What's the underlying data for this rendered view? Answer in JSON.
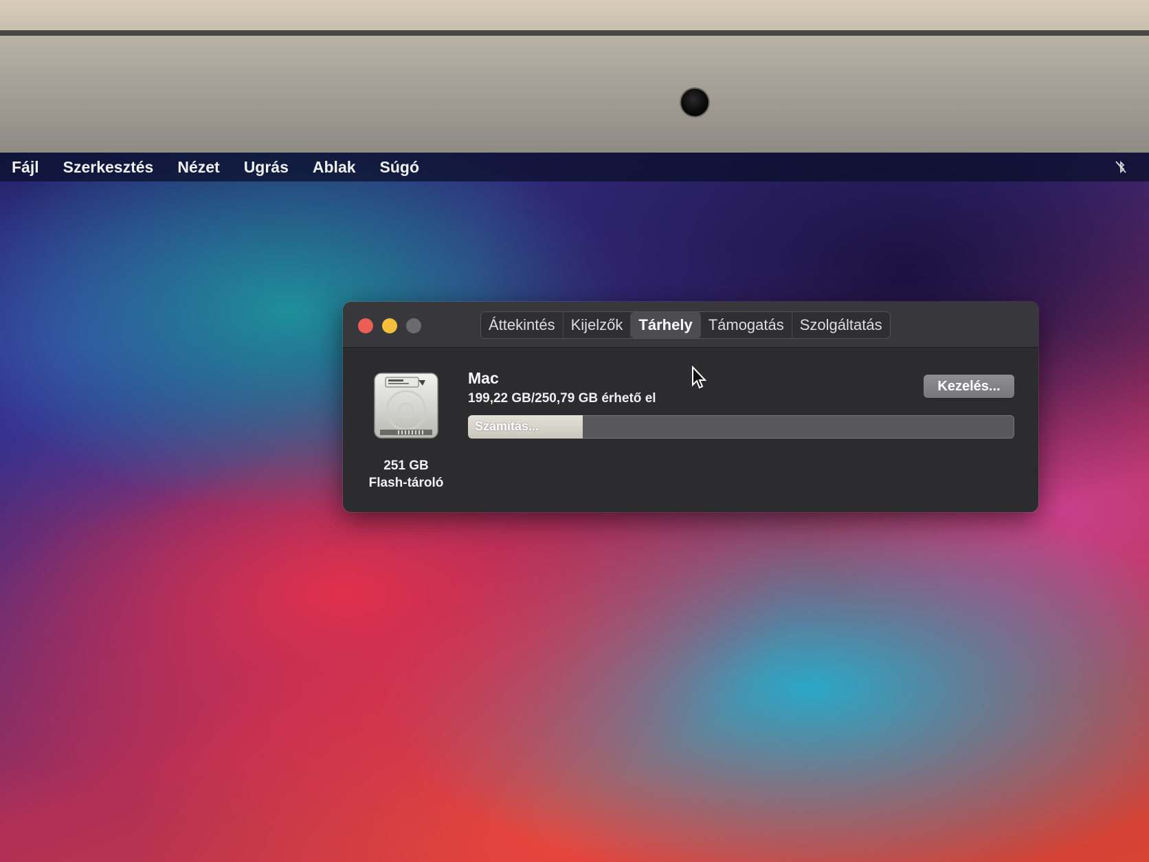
{
  "menubar": {
    "items": [
      "Fájl",
      "Szerkesztés",
      "Nézet",
      "Ugrás",
      "Ablak",
      "Súgó"
    ],
    "right_icon": "bluetooth-off-icon"
  },
  "window": {
    "tabs": [
      {
        "label": "Áttekintés",
        "active": false
      },
      {
        "label": "Kijelzők",
        "active": false
      },
      {
        "label": "Tárhely",
        "active": true
      },
      {
        "label": "Támogatás",
        "active": false
      },
      {
        "label": "Szolgáltatás",
        "active": false
      }
    ],
    "disk": {
      "icon": "hard-drive-icon",
      "size": "251 GB",
      "type": "Flash-tároló"
    },
    "volume": {
      "name": "Mac",
      "available": "199,22 GB/250,79 GB érhető el",
      "bar_label": "Számítás...",
      "bar_fill_fraction": 0.21
    },
    "manage_button": "Kezelés..."
  },
  "colors": {
    "close": "#ec5f57",
    "minimize": "#f2be3c",
    "zoom": "#6b6a6e"
  }
}
